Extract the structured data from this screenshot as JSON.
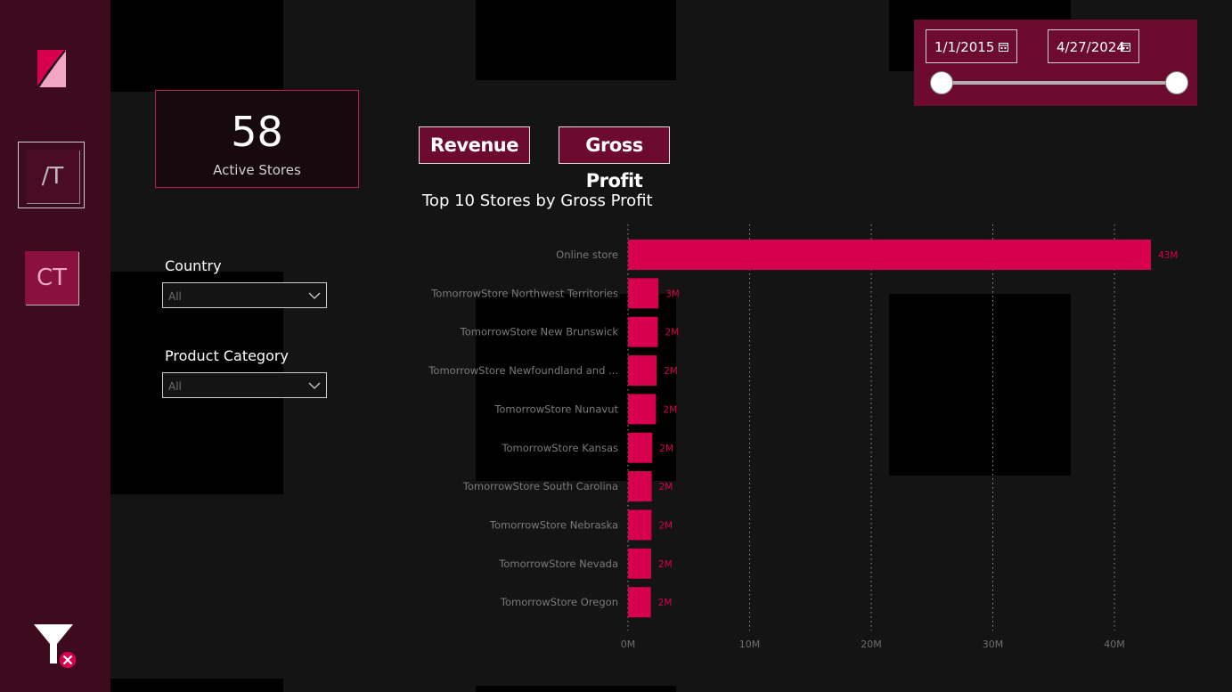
{
  "kpi": {
    "value": "58",
    "label": "Active Stores"
  },
  "filters": {
    "country": {
      "title": "Country",
      "value": "All"
    },
    "category": {
      "title": "Product Category",
      "value": "All"
    }
  },
  "nav": {
    "store_label": "/T",
    "customer_label": "CT"
  },
  "toggles": {
    "revenue": "Revenue",
    "gross_profit": "Gross Profit"
  },
  "date_range": {
    "start": "1/1/2015",
    "end": "4/27/2024",
    "slider_start": 0,
    "slider_end": 1
  },
  "colors": {
    "accent": "#d6004f",
    "panel": "#6c0a30",
    "sidebar": "#3d0a1e"
  },
  "icons": {
    "logo": "logo-icon",
    "calendar": "calendar-icon",
    "chevron": "chevron-down-icon",
    "clear_filters": "clear-filter-icon"
  },
  "chart_data": {
    "type": "bar",
    "orientation": "horizontal",
    "title": "Top 10 Stores by Gross Profit",
    "categories": [
      "Online store",
      "TomorrowStore Northwest Territories",
      "TomorrowStore New Brunswick",
      "TomorrowStore Newfoundland and ...",
      "TomorrowStore Nunavut",
      "TomorrowStore Kansas",
      "TomorrowStore South Carolina",
      "TomorrowStore Nebraska",
      "TomorrowStore Nevada",
      "TomorrowStore Oregon"
    ],
    "values": [
      43.0,
      2.5,
      2.45,
      2.35,
      2.3,
      2.0,
      1.95,
      1.93,
      1.9,
      1.88
    ],
    "data_labels": [
      "43M",
      "3M",
      "2M",
      "2M",
      "2M",
      "2M",
      "2M",
      "2M",
      "2M",
      "2M"
    ],
    "xlim": [
      0,
      43
    ],
    "x_ticks": [
      0,
      10,
      20,
      30,
      40
    ],
    "x_tick_labels": [
      "0M",
      "10M",
      "20M",
      "30M",
      "40M"
    ],
    "grid": "vertical-dotted"
  }
}
